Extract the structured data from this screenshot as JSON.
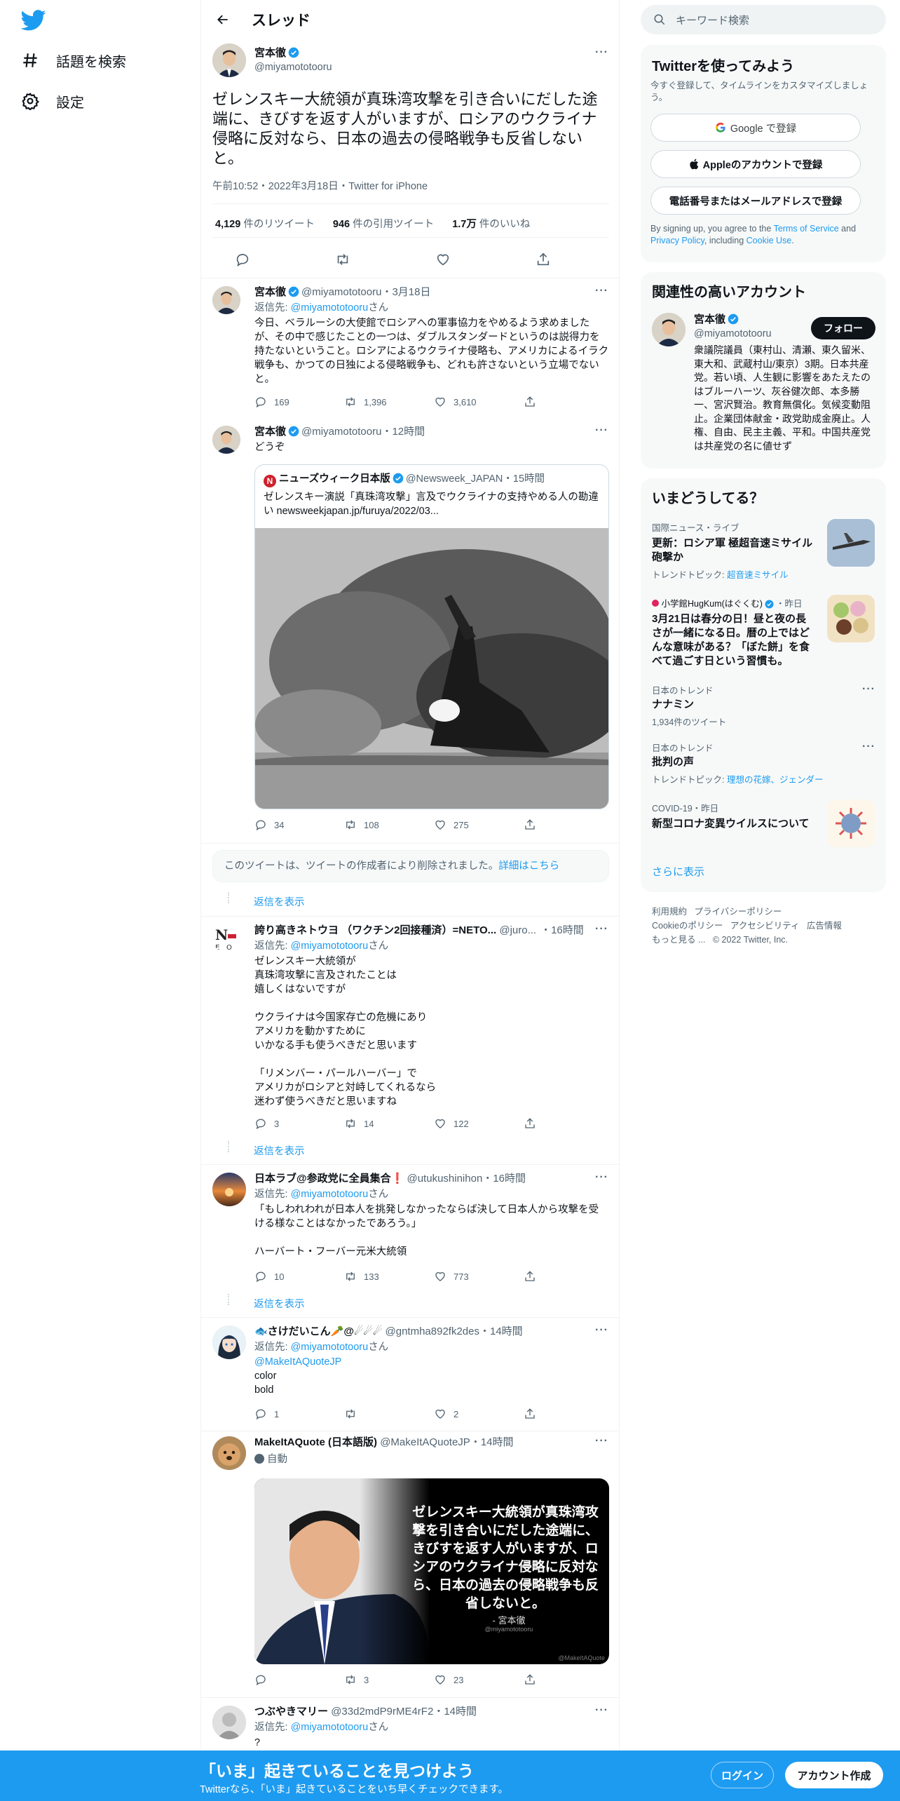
{
  "nav": {
    "explore": "話題を検索",
    "settings": "設定"
  },
  "header": {
    "title": "スレッド"
  },
  "main": {
    "name": "宮本徹",
    "handle": "@miyamototooru",
    "text": "ゼレンスキー大統領が真珠湾攻撃を引き合いにだした途端に、きびすを返す人がいますが、ロシアのウクライナ侵略に反対なら、日本の過去の侵略戦争も反省しないと。",
    "meta": "午前10:52・2022年3月18日・Twitter for iPhone",
    "retweets_n": "4,129",
    "retweets_l": "件のリツイート",
    "quotes_n": "946",
    "quotes_l": "件の引用ツイート",
    "likes_n": "1.7万",
    "likes_l": "件のいいね"
  },
  "t1": {
    "name": "宮本徹",
    "handle": "@miyamototooru",
    "time": "・3月18日",
    "reply_to": "返信先: ",
    "reply_handle": "@miyamototooru",
    "reply_san": "さん",
    "text": "今日、ベラルーシの大使館でロシアへの軍事協力をやめるよう求めましたが、その中で感じたことの一つは、ダブルスタンダードというのは説得力を持たないということ。ロシアによるウクライナ侵略も、アメリカによるイラク戦争も、かつての日独による侵略戦争も、どれも許さないという立場でないと。",
    "replies": "169",
    "retweets": "1,396",
    "likes": "3,610"
  },
  "t2": {
    "name": "宮本徹",
    "handle": "@miyamototooru",
    "time": "・12時間",
    "text": "どうぞ",
    "quote_name": "ニューズウィーク日本版",
    "quote_handle": "@Newsweek_JAPAN",
    "quote_time": "・15時間",
    "quote_text": "ゼレンスキー演説「真珠湾攻撃」言及でウクライナの支持やめる人の勘違い newsweekjapan.jp/furuya/2022/03...",
    "replies": "34",
    "retweets": "108",
    "likes": "275"
  },
  "deleted": {
    "text": "このツイートは、ツイートの作成者により削除されました。",
    "link": "詳細はこちら"
  },
  "show_replies": "返信を表示",
  "t3": {
    "name": "誇り高きネトウヨ （ワクチン2回接種済）=NETO...",
    "handle": "@juro...",
    "time": "・16時間",
    "reply_to": "返信先: ",
    "reply_handle": "@miyamototooru",
    "reply_san": "さん",
    "lines": [
      "ゼレンスキー大統領が",
      "真珠湾攻撃に言及されたことは",
      "嬉しくはないですが",
      "",
      "ウクライナは今国家存亡の危機にあり",
      "アメリカを動かすために",
      "いかなる手も使うべきだと思います",
      "",
      "「リメンバー・パールハーバー」で",
      "アメリカがロシアと対峙してくれるなら",
      "迷わず使うべきだと思いますね"
    ],
    "replies": "3",
    "retweets": "14",
    "likes": "122"
  },
  "t4": {
    "name": "日本ラブ@参政党に全員集合❗️",
    "handle": "@utukushinihon",
    "time": "・16時間",
    "reply_to": "返信先: ",
    "reply_handle": "@miyamototooru",
    "reply_san": "さん",
    "lines": [
      "「もしわれわれが日本人を挑発しなかったならば決して日本人から攻撃を受ける様なことはなかったであろう。」",
      "",
      "ハーバート・フーバー元米大統領"
    ],
    "replies": "10",
    "retweets": "133",
    "likes": "773"
  },
  "t5": {
    "name": "🐟さけだいこん🥕@☄☄☄",
    "handle": "@gntmha892fk2des",
    "time": "・14時間",
    "reply_to": "返信先: ",
    "reply_handle": "@miyamototooru",
    "reply_san": "さん",
    "mention": "@MakeItAQuoteJP",
    "lines": [
      "color",
      "bold"
    ],
    "replies": "1",
    "retweets": "",
    "likes": "2"
  },
  "t6": {
    "name": "MakeItAQuote (日本語版)",
    "handle": "@MakeItAQuoteJP",
    "time": "・14時間",
    "auto": "自動",
    "quote_img_text": "ゼレンスキー大統領が真珠湾攻撃を引き合いにだした途端に、きびすを返す人がいますが、ロシアのウクライナ侵略に反対なら、日本の過去の侵略戦争も反省しないと。",
    "quote_sign": "- 宮本徹",
    "quote_sign_handle": "@miyamototooru",
    "watermark": "@MakeItAQuote",
    "replies": "",
    "retweets": "3",
    "likes": "23"
  },
  "t7": {
    "name": "つぶやきマリー",
    "handle": "@33d2mdP9rME4rF2",
    "time": "・14時間",
    "reply_to": "返信先: ",
    "reply_handle": "@miyamototooru",
    "reply_san": "さん",
    "text": "?"
  },
  "right": {
    "search_placeholder": "キーワード検索",
    "signup_title": "Twitterを使ってみよう",
    "signup_sub": "今すぐ登録して、タイムラインをカスタマイズしましょう。",
    "google": "Google で登録",
    "apple": "Appleのアカウントで登録",
    "phone": "電話番号またはメールアドレスで登録",
    "terms_1": "By signing up, you agree to the ",
    "terms_tos": "Terms of Service",
    "terms_and": " and ",
    "terms_pp": "Privacy Policy",
    "terms_2": ", including ",
    "terms_cookie": "Cookie Use",
    "terms_3": ".",
    "related_title": "関連性の高いアカウント",
    "rel_name": "宮本徹",
    "rel_handle": "@miyamototooru",
    "follow": "フォロー",
    "rel_bio": "衆議院議員（東村山、清瀬、東久留米、東大和、武蔵村山/東京）3期。日本共産党。若い頃、人生観に影響をあたえたのはブルーハーツ、灰谷健次郎、本多勝一、宮沢賢治。教育無償化。気候変動阻止。企業団体献金・政党助成金廃止。人権、自由、民主主義、平和。中国共産党は共産党の名に値せず",
    "trends_title": "いまどうしてる？",
    "tr1_meta": "国際ニュース・ライブ",
    "tr1_name": "更新：ロシア軍 極超音速ミサイル砲撃か",
    "tr1_sub_l": "トレンドトピック: ",
    "tr1_sub": "超音速ミサイル",
    "tr2_meta": "小学館HugKum(はぐくむ)",
    "tr2_time": "・昨日",
    "tr2_name": "3月21日は春分の日！昼と夜の長さが一緒になる日。暦の上ではどんな意味がある？「ぼた餅」を食べて過ごす日という習慣も。",
    "tr3_meta": "日本のトレンド",
    "tr3_name": "ナナミン",
    "tr3_sub": "1,934件のツイート",
    "tr4_meta": "日本のトレンド",
    "tr4_name": "批判の声",
    "tr4_sub_l": "トレンドトピック: ",
    "tr4_sub": "理想の花嫁、ジェンダー",
    "tr5_meta": "COVID-19・昨日",
    "tr5_name": "新型コロナ変異ウイルスについて",
    "show_more": "さらに表示",
    "f1": "利用規約",
    "f2": "プライバシーポリシー",
    "f3": "Cookieのポリシー",
    "f4": "アクセシビリティ",
    "f5": "広告情報",
    "f6": "もっと見る ...",
    "f7": "© 2022 Twitter, Inc."
  },
  "bottom": {
    "big": "「いま」起きていることを見つけよう",
    "small": "Twitterなら、「いま」起きていることをいち早くチェックできます。",
    "login": "ログイン",
    "signup": "アカウント作成"
  },
  "colors": {
    "accent": "#1d9bf0",
    "text": "#0f1419",
    "muted": "#536471"
  }
}
